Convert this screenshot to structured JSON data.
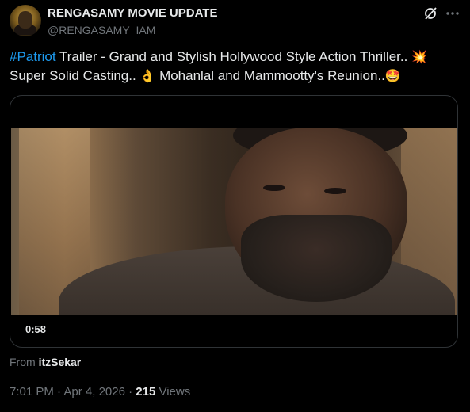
{
  "author": {
    "display_name": "RENGASAMY MOVIE UPDATE",
    "handle": "@RENGASAMY_IAM"
  },
  "icons": {
    "grok": "grok-icon",
    "more": "more-horizontal-icon"
  },
  "tweet": {
    "hashtag": "#Patriot",
    "line1": " Trailer - Grand and Stylish Hollywood Style Action Thriller.. ",
    "emoji1": "💥",
    "line2": "Super Solid Casting.. ",
    "emoji2": "👌",
    "line2b": " Mohanlal and Mammootty's Reunion..",
    "emoji3": "🤩"
  },
  "media": {
    "duration": "0:58"
  },
  "source": {
    "prefix": "From ",
    "user": "itzSekar"
  },
  "meta": {
    "time": "7:01 PM",
    "sep1": " · ",
    "date": "Apr 4, 2026",
    "sep2": " · ",
    "views_count": "215",
    "views_label": " Views"
  },
  "colors": {
    "link": "#1d9bf0",
    "secondary": "#71767b",
    "text": "#e7e9ea",
    "background": "#000000"
  }
}
